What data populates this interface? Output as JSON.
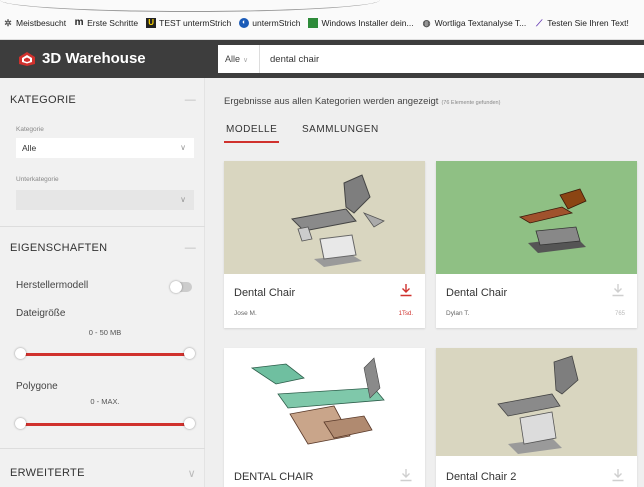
{
  "bookmarks": [
    {
      "icon": "gear-icon",
      "label": "Meistbesucht"
    },
    {
      "icon": "m-logo-icon",
      "label": "Erste Schritte"
    },
    {
      "icon": "u-logo-icon",
      "label": "TEST untermStrich"
    },
    {
      "icon": "globe-icon",
      "label": "untermStrich"
    },
    {
      "icon": "windows-installer-icon",
      "label": "Windows Installer dein..."
    },
    {
      "icon": "wortliga-icon",
      "label": "Wortliga Textanalyse T..."
    },
    {
      "icon": "pen-icon",
      "label": "Testen Sie Ihren Text!"
    }
  ],
  "header": {
    "brand": "3D Warehouse",
    "search_category": "Alle",
    "search_query": "dental chair"
  },
  "sidebar": {
    "kategorie_title": "KATEGORIE",
    "kategorie_label": "Kategorie",
    "kategorie_value": "Alle",
    "unterkategorie_label": "Unterkategorie",
    "eigenschaften_title": "EIGENSCHAFTEN",
    "herstellermodell_label": "Herstellermodell",
    "dateigroesse_label": "Dateigröße",
    "dateigroesse_range": "0 - 50 MB",
    "polygone_label": "Polygone",
    "polygone_range": "0 - MAX.",
    "erweiterte_title": "ERWEITERTE"
  },
  "main": {
    "results_text": "Ergebnisse aus allen Kategorien werden angezeigt",
    "results_count": "(76 Elemente gefunden)",
    "tabs": [
      "MODELLE",
      "SAMMLUNGEN"
    ],
    "cards": [
      {
        "title": "Dental Chair",
        "author": "Jose M.",
        "downloads": "1Tsd."
      },
      {
        "title": "Dental Chair",
        "author": "Dylan T.",
        "downloads": "765"
      },
      {
        "title": "DENTAL CHAIR",
        "author": "",
        "downloads": ""
      },
      {
        "title": "Dental Chair 2",
        "author": "",
        "downloads": ""
      }
    ]
  },
  "colors": {
    "accent": "#d0312d",
    "header_bg": "#3d3d3d",
    "thumb_green": "#8fc084",
    "thumb_beige": "#d9d6c0"
  }
}
